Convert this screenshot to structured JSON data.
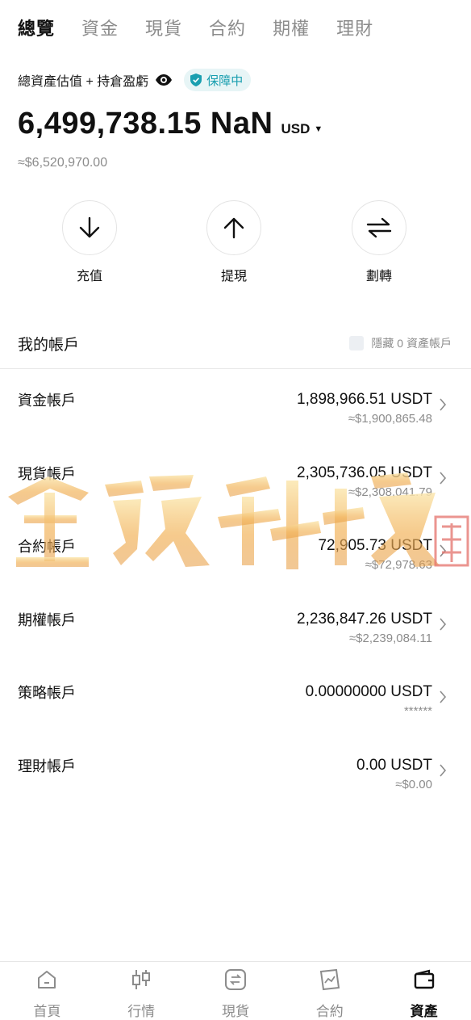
{
  "top_tabs": [
    {
      "label": "總覽",
      "active": true
    },
    {
      "label": "資金",
      "active": false
    },
    {
      "label": "現貨",
      "active": false
    },
    {
      "label": "合約",
      "active": false
    },
    {
      "label": "期權",
      "active": false
    },
    {
      "label": "理財",
      "active": false
    }
  ],
  "summary": {
    "label": "總資產估值 + 持倉盈虧",
    "eye_icon": "eye-icon",
    "badge": "保障中",
    "badge_color": "#1a9fb0",
    "total_value": "6,499,738.15 NaN",
    "currency": "USD",
    "approx": "≈$6,520,970.00"
  },
  "actions": [
    {
      "label": "充值",
      "icon": "arrow-down-icon"
    },
    {
      "label": "提現",
      "icon": "arrow-up-icon"
    },
    {
      "label": "劃轉",
      "icon": "transfer-icon"
    }
  ],
  "accounts": {
    "title": "我的帳戶",
    "hide_label": "隱藏 0 資產帳戶",
    "items": [
      {
        "name": "資金帳戶",
        "amount": "1,898,966.51 USDT",
        "approx": "≈$1,900,865.48"
      },
      {
        "name": "現貨帳戶",
        "amount": "2,305,736.05 USDT",
        "approx": "≈$2,308,041.79"
      },
      {
        "name": "合約帳戶",
        "amount": "72,905.73 USDT",
        "approx": "≈$72,978.63"
      },
      {
        "name": "期權帳戶",
        "amount": "2,236,847.26 USDT",
        "approx": "≈$2,239,084.11"
      },
      {
        "name": "策略帳戶",
        "amount": "0.00000000 USDT",
        "approx": "******"
      },
      {
        "name": "理財帳戶",
        "amount": "0.00 USDT",
        "approx": "≈$0.00"
      }
    ]
  },
  "watermark": {
    "text": "金鑫科技"
  },
  "bottom_nav": [
    {
      "label": "首頁",
      "icon": "home-icon",
      "active": false
    },
    {
      "label": "行情",
      "icon": "candlestick-icon",
      "active": false
    },
    {
      "label": "現貨",
      "icon": "spot-exchange-icon",
      "active": false
    },
    {
      "label": "合約",
      "icon": "contract-chart-icon",
      "active": false
    },
    {
      "label": "資產",
      "icon": "wallet-icon",
      "active": true
    }
  ]
}
